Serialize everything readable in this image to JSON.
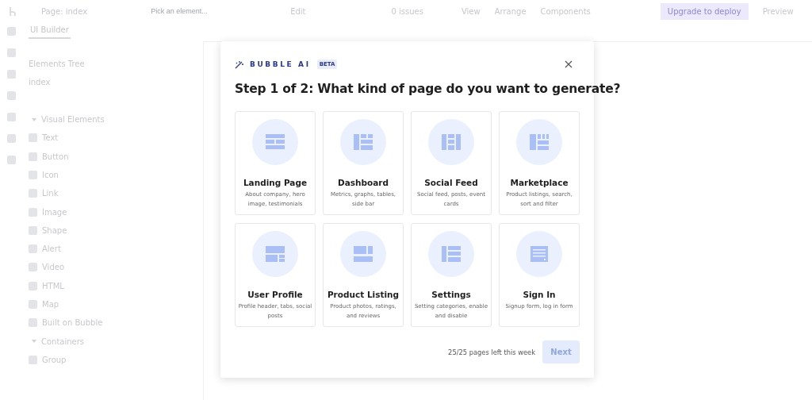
{
  "topbar": {
    "page": "Page: index",
    "element_picker": {
      "placeholder": "Pick an element..."
    },
    "mode": "Edit",
    "issues": "0 issues",
    "menu": [
      "View",
      "Arrange",
      "Components"
    ],
    "upgrade": "Upgrade to deploy",
    "preview": "Preview"
  },
  "sidebar": {
    "tabs": [
      {
        "label": "UI Builder",
        "selected": true
      }
    ],
    "tree_title": "Elements Tree",
    "page_item": "index",
    "groups": [
      {
        "label": "Visual Elements",
        "expanded": true,
        "items": [
          "Text",
          "Button",
          "Icon",
          "Link",
          "Image",
          "Shape",
          "Alert",
          "Video",
          "HTML",
          "Map",
          "Built on Bubble"
        ]
      },
      {
        "label": "Containers",
        "expanded": true,
        "items": [
          "Group"
        ]
      }
    ]
  },
  "dialog": {
    "brand": "BUBBLE AI",
    "badge": "BETA",
    "title": "Step 1 of 2: What kind of page do you want to generate?",
    "options": [
      {
        "title": "Landing Page",
        "description": "About company, hero image, testimonials",
        "selected": false
      },
      {
        "title": "Dashboard",
        "description": "Metrics, graphs, tables, side bar",
        "selected": false
      },
      {
        "title": "Social Feed",
        "description": "Social feed, posts, event cards",
        "selected": false
      },
      {
        "title": "Marketplace",
        "description": "Product listings, search, sort and filter",
        "selected": false
      },
      {
        "title": "User Profile",
        "description": "Profile header, tabs, social posts",
        "selected": false
      },
      {
        "title": "Product Listing",
        "description": "Product photos, ratings, and reviews",
        "selected": false
      },
      {
        "title": "Settings",
        "description": "Setting categories, enable and disable",
        "selected": false
      },
      {
        "title": "Sign In",
        "description": "Signup form, log in form",
        "selected": false
      }
    ],
    "quota": "25/25 pages left this week",
    "next": {
      "label": "Next",
      "disabled": true
    }
  }
}
